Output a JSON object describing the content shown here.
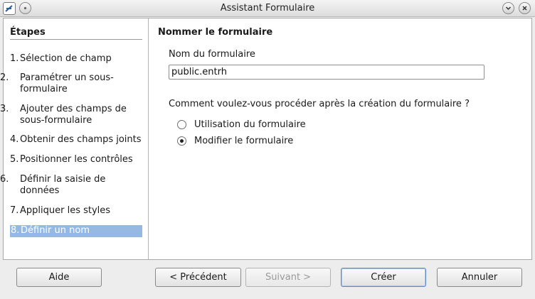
{
  "window": {
    "title": "Assistant Formulaire",
    "app_icon": "form-wizard-icon",
    "buttons": [
      "menu-icon",
      "minimize-icon",
      "close-icon"
    ]
  },
  "sidebar": {
    "title": "Étapes",
    "steps": [
      {
        "num": "1.",
        "label": "Sélection de champ"
      },
      {
        "num": "2.",
        "label": "Paramétrer un sous-formulaire"
      },
      {
        "num": "3.",
        "label": "Ajouter des champs de sous-formulaire"
      },
      {
        "num": "4.",
        "label": "Obtenir des champs joints"
      },
      {
        "num": "5.",
        "label": "Positionner les contrôles"
      },
      {
        "num": "6.",
        "label": "Définir la saisie de données"
      },
      {
        "num": "7.",
        "label": "Appliquer les styles"
      },
      {
        "num": "8.",
        "label": "Définir un nom"
      }
    ],
    "active_step": 8
  },
  "main": {
    "section_title": "Nommer le formulaire",
    "name_label": "Nom du formulaire",
    "name_value": "public.entrh",
    "question": "Comment voulez-vous procéder après la création du formulaire ?",
    "options": [
      {
        "label": "Utilisation du formulaire",
        "checked": false
      },
      {
        "label": "Modifier le formulaire",
        "checked": true
      }
    ]
  },
  "footer": {
    "help": "Aide",
    "previous": "< Précédent",
    "next": "Suivant >",
    "finish": "Créer",
    "cancel": "Annuler"
  },
  "colors": {
    "selection": "#95b9e2",
    "focus_border": "#5d8cc9"
  }
}
